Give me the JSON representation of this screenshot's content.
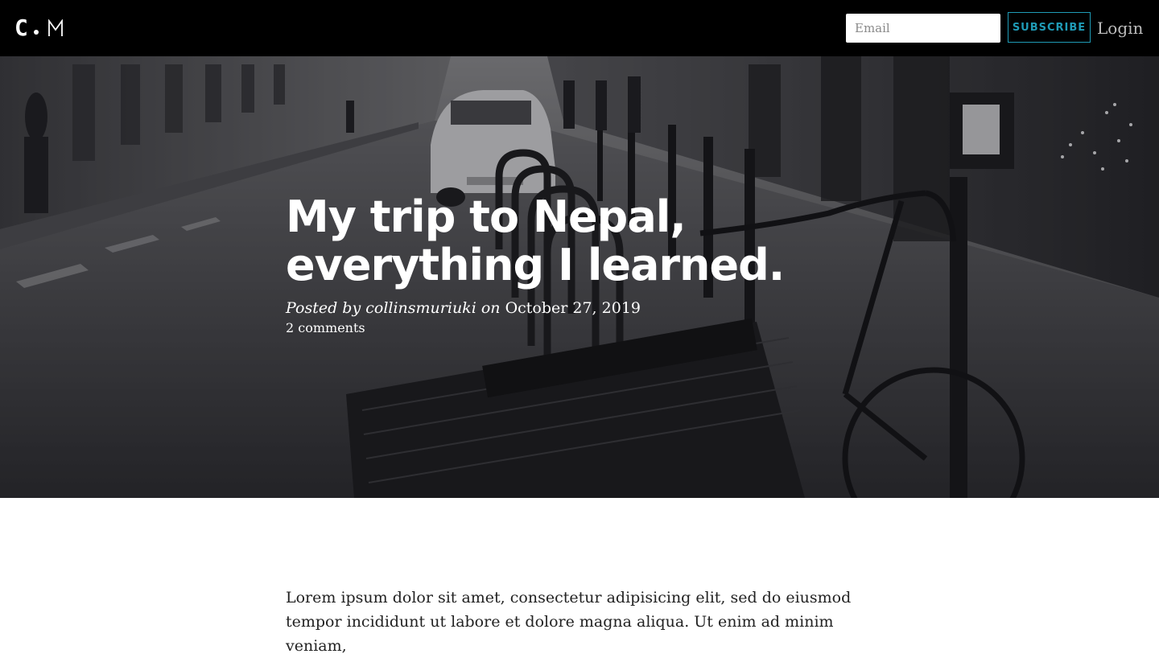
{
  "nav": {
    "logo_letter": "C",
    "email_placeholder": "Email",
    "subscribe_label": "SUBSCRIBE",
    "login_label": "Login",
    "accent_color": "#1f9bb6"
  },
  "post": {
    "title_line1": "My trip to Nepal,",
    "title_line2": "everything I learned.",
    "posted_by_label": "Posted by",
    "author": "collinsmuriuki",
    "on_label": "on",
    "date": "October 27, 2019",
    "comments": "2 comments",
    "hero_image": "black-and-white street with parked bicycles"
  },
  "article": {
    "paragraph": "Lorem ipsum dolor sit amet, consectetur adipisicing elit, sed do eiusmod tempor incididunt ut labore et dolore magna aliqua. Ut enim ad minim veniam,"
  }
}
